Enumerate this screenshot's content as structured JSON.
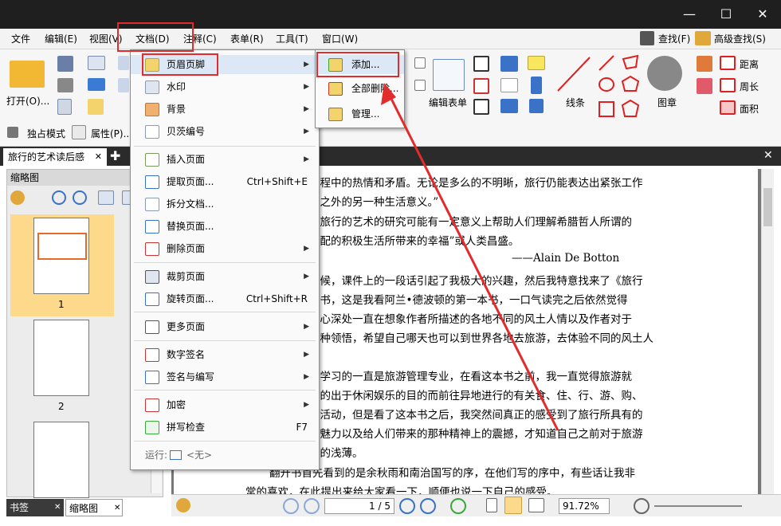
{
  "menubar": {
    "items": [
      "文件",
      "编辑(E)",
      "视图(V)",
      "文档(D)",
      "注释(C)",
      "表单(R)",
      "工具(T)",
      "窗口(W)"
    ],
    "find": "查找(F)",
    "advanced_find": "高级查找(S)"
  },
  "toolbar": {
    "open": "打开(O)...",
    "exclusive_mode": "独占模式",
    "properties": "属性(P)...",
    "edit_form": "编辑表单",
    "line": "线条",
    "stamp": "图章",
    "distance": "距离",
    "perimeter": "周长",
    "area": "面积"
  },
  "doc_tab": {
    "title": "旅行的艺术读后感"
  },
  "left_panel": {
    "title": "缩略图",
    "pages": [
      "1",
      "2"
    ]
  },
  "document_menu": {
    "items": [
      {
        "label": "页眉页脚",
        "shortcut": "",
        "submenu": true
      },
      {
        "label": "水印",
        "shortcut": "",
        "submenu": true
      },
      {
        "label": "背景",
        "shortcut": "",
        "submenu": true
      },
      {
        "label": "贝茨编号",
        "shortcut": "",
        "submenu": true
      },
      {
        "label": "插入页面",
        "shortcut": "",
        "submenu": true
      },
      {
        "label": "提取页面...",
        "shortcut": "Ctrl+Shift+E",
        "submenu": false
      },
      {
        "label": "拆分文档...",
        "shortcut": "",
        "submenu": false
      },
      {
        "label": "替换页面...",
        "shortcut": "",
        "submenu": false
      },
      {
        "label": "删除页面",
        "shortcut": "",
        "submenu": true
      },
      {
        "label": "裁剪页面",
        "shortcut": "",
        "submenu": true
      },
      {
        "label": "旋转页面...",
        "shortcut": "Ctrl+Shift+R",
        "submenu": false
      },
      {
        "label": "更多页面",
        "shortcut": "",
        "submenu": true
      },
      {
        "label": "数字签名",
        "shortcut": "",
        "submenu": true
      },
      {
        "label": "签名与编写",
        "shortcut": "",
        "submenu": true
      },
      {
        "label": "加密",
        "shortcut": "",
        "submenu": true
      },
      {
        "label": "拼写检查",
        "shortcut": "F7",
        "submenu": false
      }
    ],
    "run_label": "运行:",
    "run_value": "<无>"
  },
  "header_footer_submenu": {
    "items": [
      "添加...",
      "全部删除...",
      "管理..."
    ]
  },
  "document_text": {
    "lines": [
      "过程中的热情和矛盾。无论是多么的不明晰，旅行仍能表达出紧张工作",
      "生之外的另一种生活意义。”",
      "对旅行的艺术的研究可能有一定意义上帮助人们理解希腊哲人所谓的",
      "支配的积极生活所带来的幸福”或人类昌盛。",
      "——Alain De Botton",
      "时候，课件上的一段话引起了我极大的兴趣，然后我特意找来了《旅行",
      "本书，这是我看阿兰•德波顿的第一本书，一口气读完之后依然觉得",
      "内心深处一直在想象作者所描述的各地不同的风土人情以及作者对于",
      "各种领悟，希望自己哪天也可以到世界各地去旅游，去体验不同的风土人",
      "",
      "己学习的一直是旅游管理专业，在看这本书之前，我一直觉得旅游就",
      "范的出于休闲娱乐的目的而前往异地进行的有关食、住、行、游、购、",
      "列活动，但是看了这本书之后，我突然间真正的感受到了旅行所具有的",
      "的魅力以及给人们带来的那种精神上的震撼，才知道自己之前对于旅游",
      "么的浅薄。",
      "翻开书首先看到的是余秋雨和南治国写的序，在他们写的序中，有些话让我非",
      "常的喜欢，在此提出来给大家看一下，顺便也说一下自己的感受。"
    ]
  },
  "status_bar": {
    "page_indicator": "1 / 5",
    "zoom": "91.72%"
  },
  "bottom_tabs": {
    "bookmarks": "书签",
    "thumbnails": "缩略图"
  },
  "colors": {
    "highlight_red": "#e22b2b",
    "menu_bg": "#fafafa",
    "title_bar": "#1f1f1f",
    "selected_thumb": "#fcd98b"
  }
}
